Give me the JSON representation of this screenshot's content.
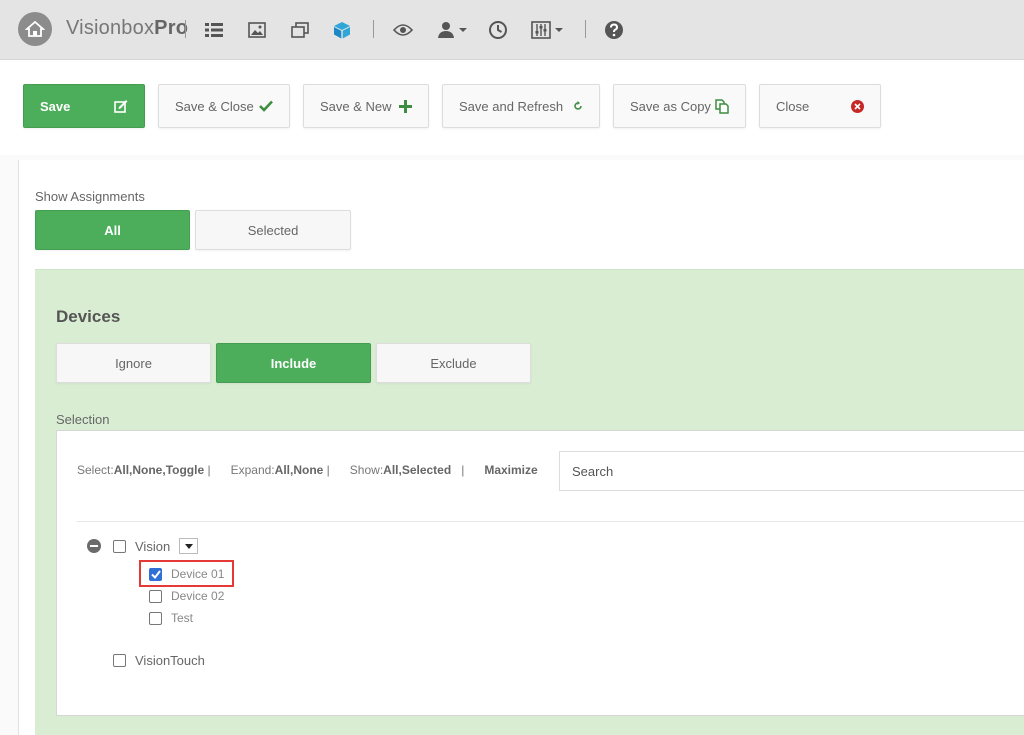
{
  "app": {
    "brand_light": "Visionbox",
    "brand_bold": "Pro"
  },
  "nav_icons": [
    "home-icon",
    "list-icon",
    "image-icon",
    "windows-icon",
    "cube-icon",
    "eye-icon",
    "user-icon",
    "clock-icon",
    "sliders-icon",
    "help-icon"
  ],
  "toolbar": {
    "save": "Save",
    "save_close": "Save & Close",
    "save_new": "Save & New",
    "save_refresh": "Save and Refresh",
    "save_copy": "Save as Copy",
    "close": "Close"
  },
  "assignments": {
    "label": "Show Assignments",
    "all": "All",
    "selected": "Selected",
    "active": "All"
  },
  "devices": {
    "title": "Devices",
    "modes": [
      "Ignore",
      "Include",
      "Exclude"
    ],
    "active_mode": "Include",
    "selection_label": "Selection",
    "tools": {
      "select_label": "Select:",
      "select_options": "All,None,Toggle",
      "expand_label": "Expand:",
      "expand_options": "All,None",
      "show_label": "Show:",
      "show_options": "All,Selected",
      "maximize": "Maximize",
      "sep": "|"
    },
    "search_placeholder": "Search",
    "tree": {
      "group1": {
        "label": "Vision",
        "checked": false
      },
      "children": [
        {
          "label": "Device 01",
          "checked": true
        },
        {
          "label": "Device 02",
          "checked": false
        },
        {
          "label": "Test",
          "checked": false
        }
      ],
      "group2": {
        "label": "VisionTouch",
        "checked": false
      }
    }
  },
  "colors": {
    "primary_green": "#4cae5a",
    "panel_green": "#d9edd3",
    "navbar": "#e4e4e4",
    "close_red": "#c62828",
    "highlight": "#e53935",
    "checkbox_blue": "#2f6fd6"
  }
}
